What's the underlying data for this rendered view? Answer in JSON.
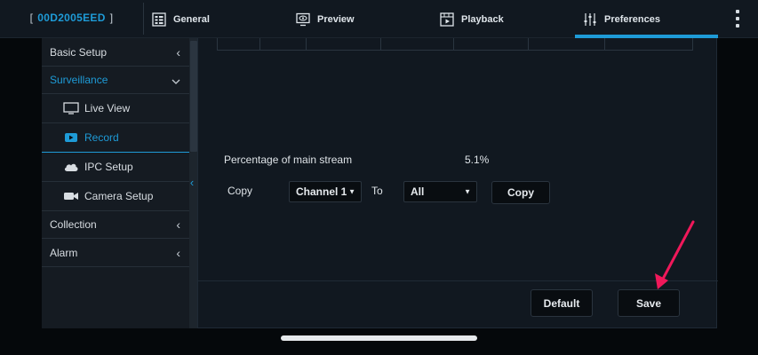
{
  "device": {
    "id": "00D2005EED",
    "bracket_left": "[",
    "bracket_right": "]"
  },
  "nav": {
    "tabs": [
      {
        "label": "General",
        "icon": "grid-icon"
      },
      {
        "label": "Preview",
        "icon": "eye-monitor-icon"
      },
      {
        "label": "Playback",
        "icon": "film-icon"
      },
      {
        "label": "Preferences",
        "icon": "sliders-icon",
        "active": true
      }
    ]
  },
  "sidebar": {
    "items": [
      {
        "label": "Basic Setup",
        "icon": "chevron-left-icon"
      },
      {
        "label": "Surveillance",
        "icon": "chevron-down-icon",
        "expanded": true
      },
      {
        "label": "Live View",
        "icon": "monitor-icon"
      },
      {
        "label": "Record",
        "icon": "record-icon",
        "selected": true
      },
      {
        "label": "IPC Setup",
        "icon": "cloud-icon"
      },
      {
        "label": "Camera Setup",
        "icon": "video-camera-icon"
      },
      {
        "label": "Collection",
        "icon": "chevron-left-icon"
      },
      {
        "label": "Alarm",
        "icon": "chevron-left-icon"
      }
    ]
  },
  "main": {
    "percentage_label": "Percentage of main stream",
    "percentage_value": "5.1%",
    "copy_label": "Copy",
    "copy_from": "Channel 1",
    "to_label": "To",
    "copy_to": "All",
    "copy_button": "Copy",
    "default_button": "Default",
    "save_button": "Save"
  },
  "colors": {
    "accent": "#1e9bd7",
    "annotation_arrow": "#f0185a"
  }
}
